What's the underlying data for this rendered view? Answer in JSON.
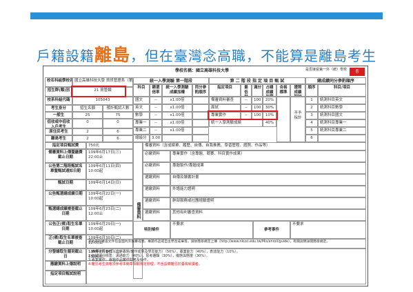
{
  "slide": {
    "title_before": "戶籍設籍",
    "title_highlight": "離島",
    "title_after": "，但在臺灣念高職，不能算是離島考生"
  },
  "doc": {
    "school_label": "學校名稱：國立高雄科技大學",
    "top_right": "是否接受第一外（統）學校",
    "top_right_stamp": "否",
    "left_rows": [
      {
        "label": "校名科組學校名稱",
        "value": "國立高雄科技大學 資訊管理系（第一科系）"
      },
      {
        "label": "招生群(類)別",
        "value": "21 資管類"
      },
      {
        "label": "校系科組代碼",
        "value": "105043"
      },
      {
        "label": "考生身分",
        "value_a": "招生名額",
        "value_b": "預計甄試人數"
      },
      {
        "label": "一般生",
        "value_a": "25",
        "value_b": "75"
      },
      {
        "label": "低收或中低收入戶考生",
        "value_a": "0",
        "value_b": "0"
      },
      {
        "label": "原住民考生",
        "value_a": "2",
        "value_b": "6"
      },
      {
        "label": "離島考生",
        "value_a": "2",
        "value_b": "6"
      }
    ],
    "schedule": [
      {
        "label": "指定項目甄試費",
        "value": "750元"
      },
      {
        "label": "備審資料上傳暨繳費截止日期",
        "value": "109年6月17日(三) 22:00止"
      },
      {
        "label": "公告第二階段甄試名單暨甄試通知日期",
        "value": "109年6月11日(四) 10:00起"
      },
      {
        "label": "甄試日期",
        "value": "109年6月14日(日)"
      },
      {
        "label": "公告甄選總成績日期",
        "value": "109年6月22日(一) 10:00起"
      },
      {
        "label": "甄選總成績複查截止日期",
        "value": "109年6月23日(二) 12:00止"
      },
      {
        "label": "公告正(備)取生名單日期",
        "value": "109年6月29日(一) 10:00起"
      },
      {
        "label": "正(備)取生名單複查截止日期",
        "value": "109年6月30日(二) 12:00止"
      },
      {
        "label": "分發錄取生報到截止日",
        "value": "109年7月14日(二) 15:00止"
      }
    ],
    "stage1_header": "統一入學測驗 第一階段",
    "stage2_header": "第 二 階 段 指 定 項 目 甄 試",
    "stage1_cols": [
      "科目",
      "篩選倍率",
      "統一入學測驗成績加權",
      "同分參酌順序"
    ],
    "stage2_cols": [
      "指定項目",
      "最低分數",
      "滿分",
      "占總成績比例",
      "合格標準",
      "證照成績加分"
    ],
    "stage1_rows": [
      {
        "subject": "國文",
        "ratio": "--",
        "weight": "x1.00倍",
        "order": ""
      },
      {
        "subject": "英文",
        "ratio": "--",
        "weight": "x1.00倍",
        "order": ""
      },
      {
        "subject": "數學",
        "ratio": "--",
        "weight": "x1.00倍",
        "order": ""
      },
      {
        "subject": "專業一",
        "ratio": "--",
        "weight": "x1.00倍",
        "order": ""
      },
      {
        "subject": "專業二",
        "ratio": "--",
        "weight": "x1.00倍",
        "order": ""
      },
      {
        "subject": "總級分",
        "ratio": "3.00",
        "weight": "",
        "order": ""
      }
    ],
    "stage2_rows": [
      {
        "item": "備審資料審查",
        "min": "--",
        "full": "100",
        "pct": "20%"
      },
      {
        "item": "面試",
        "min": "--",
        "full": "100",
        "pct": "30%"
      },
      {
        "item": "專業實作",
        "min": "--",
        "full": "100",
        "pct": "10%"
      }
    ],
    "stage2_note": "統一入學測驗成績",
    "stage2_note_pct": "40%",
    "license_note": "不予採計",
    "tie_header": "總成績同分參酌順序",
    "tie_cols": [
      "順序",
      "科目/項目"
    ],
    "tie_rows": [
      {
        "n": "1",
        "item": "統測科目英文"
      },
      {
        "n": "2",
        "item": "統測科目數學"
      },
      {
        "n": "3",
        "item": "統測科目國文"
      },
      {
        "n": "4",
        "item": "統測科目專業一"
      },
      {
        "n": "5",
        "item": "統測科目專業二"
      },
      {
        "n": "6",
        "item": ""
      }
    ],
    "review_label": "備審資料",
    "review_header": "備審資料（含成績單、履歷、自傳、自我推薦、學習歷程、證照、作品等）",
    "review_rows": [
      {
        "type": "必繳資料",
        "text": "專業實作（含專題、競賽、科目實作成果）"
      },
      {
        "type": "必繳資料",
        "text": "專題製作/專題成果"
      },
      {
        "type": "選繳資料",
        "text": "自傳及讀書計畫"
      },
      {
        "type": "選繳資料",
        "text": "外語能力證明"
      },
      {
        "type": "選繳資料",
        "text": "幹部服務或社團經驗證明"
      },
      {
        "type": "選繳資料",
        "text": "其他有利審查資料"
      }
    ],
    "special_label": "特別條件",
    "special_value": "不要求",
    "ref_label": "參考事件",
    "ref_value": "不要求",
    "notes_label": "應繳資料上傳說明",
    "notes_value": "其他有利審查文件包含國內外競賽得獎、專題作品或自主學習成果等，請依簡章規定上傳（http://www.nkust.edu.tw/Mis/enroll/guide），有關說明詳閱簡章規定。",
    "remark_label": "指定項目甄試說明",
    "remark_lines": [
      "1.備審資料審查（合併專題/實作成果及學習能力）（50%），專業能力（40%），表達能力（10%）。",
      "2.面試評分標準：溝通能力（40%），思考邏輯（30%），儀態與態度（30%）。",
      "3.專業實作：專題作品實作問答及操作。",
      "4.離島考生資格須參考本簡章相關規定辦理，不含設籍離島於臺灣就讀者。"
    ]
  }
}
